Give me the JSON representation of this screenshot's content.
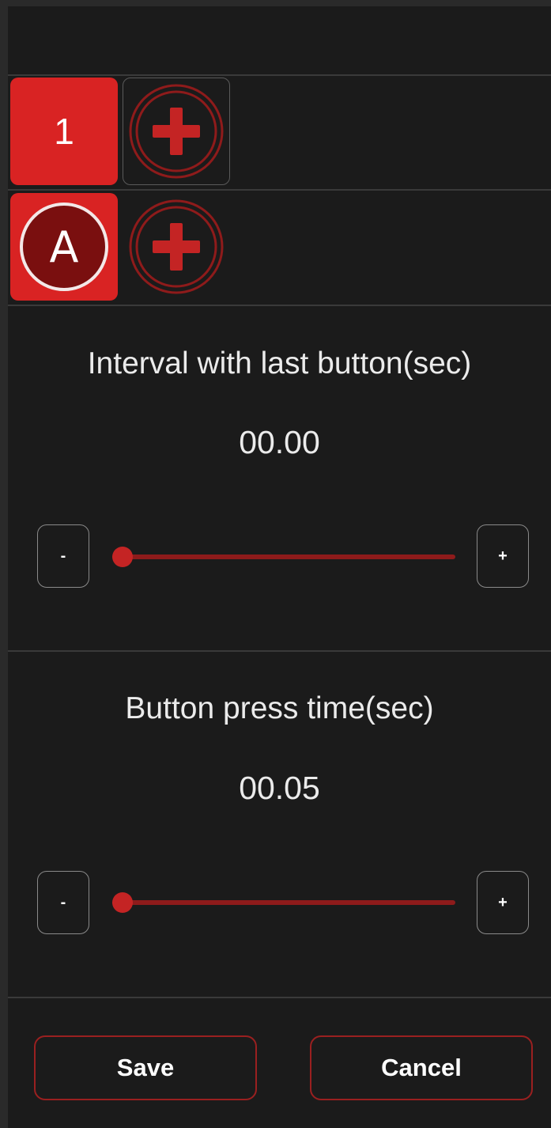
{
  "sequence": {
    "rows": [
      {
        "key_type": "number",
        "key_label": "1"
      },
      {
        "key_type": "letter",
        "key_label": "A"
      }
    ],
    "add_icon": "plus-circle-icon"
  },
  "interval": {
    "title": "Interval with last button(sec)",
    "value": "00.00",
    "slider_fraction": 0.0,
    "minus_label": "-",
    "plus_label": "+"
  },
  "press": {
    "title": "Button press time(sec)",
    "value": "00.05",
    "slider_fraction": 0.0,
    "minus_label": "-",
    "plus_label": "+"
  },
  "actions": {
    "save_label": "Save",
    "cancel_label": "Cancel"
  },
  "colors": {
    "accent_red": "#d92323",
    "dark_red": "#7a0f0f",
    "background": "#1b1b1b"
  }
}
